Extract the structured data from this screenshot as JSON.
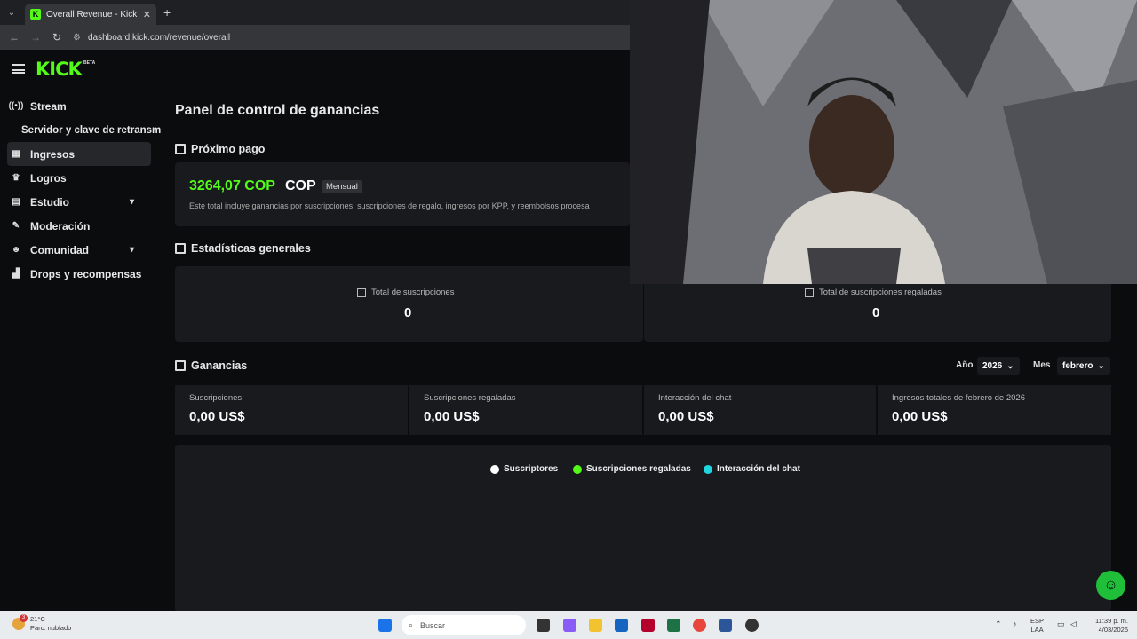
{
  "browser": {
    "tab_title": "Overall Revenue - Kick Dashbo",
    "tab_close": "✕",
    "new_tab": "+",
    "url": "dashboard.kick.com/revenue/overall"
  },
  "header": {
    "logo": "KICK",
    "logo_badge": "BETA"
  },
  "sidebar": {
    "items": [
      {
        "label": "Stream"
      },
      {
        "label": "Servidor y clave de retransm"
      },
      {
        "label": "Ingresos"
      },
      {
        "label": "Logros"
      },
      {
        "label": "Estudio"
      },
      {
        "label": "Moderación"
      },
      {
        "label": "Comunidad"
      },
      {
        "label": "Drops y recompensas"
      }
    ]
  },
  "main": {
    "title": "Panel de control de ganancias",
    "next_payout": {
      "heading": "Próximo pago",
      "amount": "3264,07 COP",
      "currency": "COP",
      "badge": "Mensual",
      "note": "Este total incluye ganancias por suscripciones, suscripciones de regalo, ingresos por KPP, y reembolsos procesa"
    },
    "stats": {
      "heading": "Estadísticas generales",
      "total_subs_label": "Total de suscripciones",
      "total_subs_value": "0",
      "gifted_subs_label": "Total de suscripciones regaladas",
      "gifted_subs_value": "0"
    },
    "earnings": {
      "heading": "Ganancias",
      "year_label": "Año",
      "year_value": "2026",
      "month_label": "Mes",
      "month_value": "febrero",
      "cells": [
        {
          "label": "Suscripciones",
          "value": "0,00 US$"
        },
        {
          "label": "Suscripciones regaladas",
          "value": "0,00 US$"
        },
        {
          "label": "Interacción del chat",
          "value": "0,00 US$"
        },
        {
          "label": "Ingresos totales de febrero de 2026",
          "value": "0,00 US$"
        }
      ],
      "legend": [
        {
          "label": "Suscriptores",
          "color": "#ffffff"
        },
        {
          "label": "Suscripciones regaladas",
          "color": "#53fc18"
        },
        {
          "label": "Interacción del chat",
          "color": "#1fd6e0"
        }
      ]
    }
  },
  "taskbar": {
    "weather_temp": "21°C",
    "weather_desc": "Parc. nublado",
    "weather_badge": "3",
    "search_placeholder": "Buscar",
    "lang_top": "ESP",
    "lang_bottom": "LAA",
    "time": "11:39 p. m.",
    "date": "4/03/2026"
  },
  "colors": {
    "accent": "#53fc18",
    "background": "#0b0c0e",
    "card": "#191a1e"
  }
}
